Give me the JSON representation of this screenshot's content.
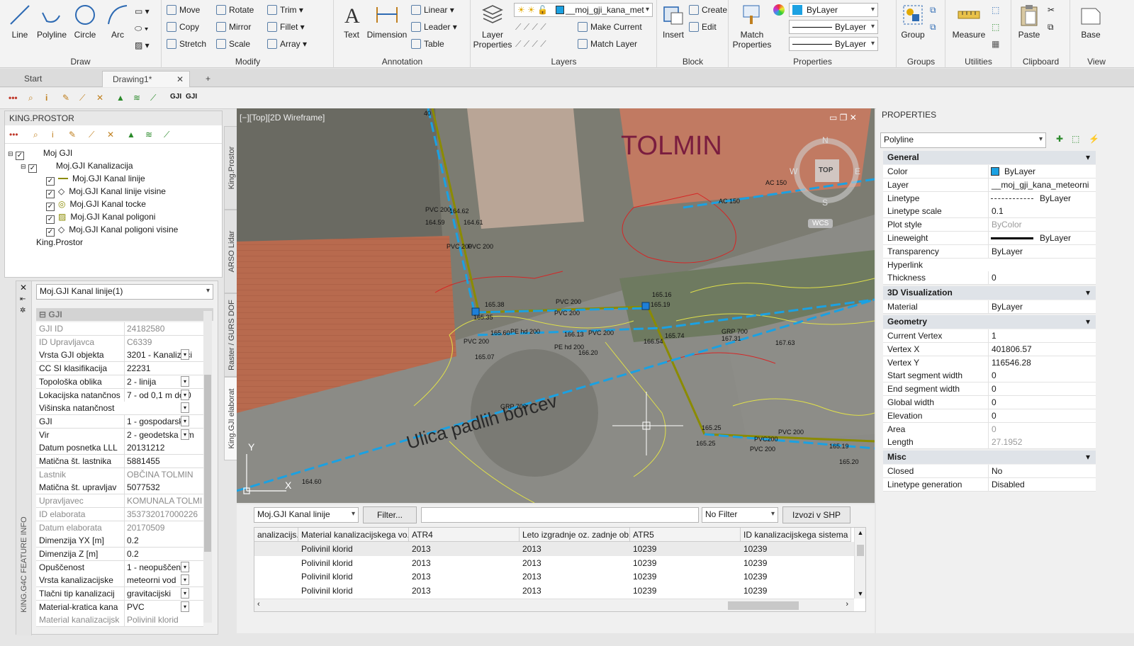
{
  "ribbon": {
    "draw": {
      "label": "Draw",
      "line": "Line",
      "polyline": "Polyline",
      "circle": "Circle",
      "arc": "Arc"
    },
    "modify": {
      "label": "Modify",
      "move": "Move",
      "rotate": "Rotate",
      "trim": "Trim",
      "copy": "Copy",
      "mirror": "Mirror",
      "fillet": "Fillet",
      "stretch": "Stretch",
      "scale": "Scale",
      "array": "Array"
    },
    "annotation": {
      "label": "Annotation",
      "text": "Text",
      "dimension": "Dimension",
      "linear": "Linear",
      "leader": "Leader",
      "table": "Table"
    },
    "layers": {
      "label": "Layers",
      "layer_properties": "Layer Properties",
      "current_layer": "__moj_gji_kana_met",
      "make_current": "Make Current",
      "match_layer": "Match Layer"
    },
    "block": {
      "label": "Block",
      "insert": "Insert",
      "create": "Create",
      "edit": "Edit"
    },
    "properties": {
      "label": "Properties",
      "match_properties": "Match Properties",
      "color": "ByLayer",
      "linetype": "ByLayer",
      "lineweight": "ByLayer"
    },
    "groups": {
      "label": "Groups",
      "group": "Group"
    },
    "utilities": {
      "label": "Utilities",
      "measure": "Measure"
    },
    "clipboard": {
      "label": "Clipboard",
      "paste": "Paste"
    },
    "view": {
      "label": "View",
      "base": "Base"
    }
  },
  "tabs": [
    {
      "label": "Start"
    },
    {
      "label": "Drawing1*"
    }
  ],
  "king_panel": {
    "title": "KING.PROSTOR",
    "tree": [
      "Moj GJI",
      "Moj.GJI Kanalizacija",
      "Moj.GJI Kanal linije",
      "Moj.GJI Kanal linije visine",
      "Moj.GJI Kanal tocke",
      "Moj.GJI Kanal poligoni",
      "Moj.GJI Kanal poligoni visine",
      "King.Prostor"
    ]
  },
  "side_tabs": [
    "King.Prostor",
    "ARSO Lidar",
    "Raster / GURS DOF",
    "King.GJI elaborat"
  ],
  "feature_panel": {
    "vertical_title": "KING.G4C FEATURE INFO",
    "selector": "Moj.GJI Kanal linije(1)",
    "group": "GJI",
    "rows": [
      {
        "k": "GJI ID",
        "v": "24182580",
        "gray": true
      },
      {
        "k": "ID Upravljavca",
        "v": "C6339",
        "gray": true
      },
      {
        "k": "Vrsta GJI objekta",
        "v": "3201 - Kanalizaci",
        "dd": true
      },
      {
        "k": "CC SI klasifikacija",
        "v": "22231"
      },
      {
        "k": "Topološka oblika",
        "v": "2 - linija",
        "dd": true
      },
      {
        "k": "Lokacijska natančnos",
        "v": "7 - od 0,1 m do 0",
        "dd": true
      },
      {
        "k": "Višinska natančnost",
        "v": "",
        "dd": true
      },
      {
        "k": "GJI",
        "v": "1 - gospodarska",
        "dd": true
      },
      {
        "k": "Vir",
        "v": "2 - geodetska izm",
        "dd": true
      },
      {
        "k": "Datum posnetka LLL",
        "v": "20131212"
      },
      {
        "k": "Matična št. lastnika",
        "v": "5881455"
      },
      {
        "k": "Lastnik",
        "v": "OBČINA TOLMIN",
        "gray": true
      },
      {
        "k": "Matična št. upravljav",
        "v": "5077532"
      },
      {
        "k": "Upravljavec",
        "v": "KOMUNALA TOLMII",
        "gray": true
      },
      {
        "k": "ID elaborata",
        "v": "353732017000226",
        "gray": true
      },
      {
        "k": "Datum elaborata",
        "v": "20170509",
        "gray": true
      },
      {
        "k": "Dimenzija YX [m]",
        "v": "0.2"
      },
      {
        "k": "Dimenzija Z [m]",
        "v": "0.2"
      },
      {
        "k": "Opuščenost",
        "v": "1 - neopuščeni o",
        "dd": true
      },
      {
        "k": "Vrsta kanalizacijske",
        "v": "meteorni vod",
        "dd": true
      },
      {
        "k": "Tlačni tip kanalizacij",
        "v": "gravitacijski",
        "dd": true
      },
      {
        "k": "Material-kratica kana",
        "v": "PVC",
        "dd": true
      },
      {
        "k": "Material kanalizacijsk",
        "v": "Polivinil klorid",
        "gray": true
      }
    ]
  },
  "viewport": {
    "label": "[−][Top][2D Wireframe]",
    "town": "TOLMIN",
    "street": "Ulica padlih borcev",
    "compass": {
      "n": "N",
      "s": "S",
      "e": "E",
      "w": "W",
      "top": "TOP",
      "wcs": "WCS"
    },
    "ucs": {
      "x": "X",
      "y": "Y"
    },
    "labels": [
      "PVC 200",
      "164.62",
      "164.59",
      "164.61",
      "PVC 200",
      "PVC 200",
      "165.38",
      "165.35",
      "PVC 200",
      "165.16",
      "165.19",
      "PVC 200",
      "PE hd 200",
      "166.13",
      "PVC 200",
      "165.60",
      "PVC 200",
      "165.07",
      "PE hd 200",
      "166.20",
      "165.74",
      "166.54",
      "GRP 700",
      "167.31",
      "167.63",
      "PVC 200",
      "GRP 700",
      "165.25",
      "165.25",
      "PVC200",
      "PVC 200",
      "165.19",
      "165.20",
      "164.60",
      "AC 150",
      "AC 150",
      "40"
    ]
  },
  "grid": {
    "layer_select": "Moj.GJI Kanal linije",
    "filter_button": "Filter...",
    "filter_text": "",
    "filter_mode": "No Filter",
    "export_button": "Izvozi v SHP",
    "columns": [
      "analizacijs...",
      "Material kanalizacijskega vo...",
      "ATR4",
      "Leto izgradnje oz. zadnje ob...",
      "ATR5",
      "ID kanalizacijskega sistema"
    ],
    "rows": [
      [
        "",
        "Polivinil klorid",
        "2013",
        "2013",
        "10239",
        "10239"
      ],
      [
        "",
        "Polivinil klorid",
        "2013",
        "2013",
        "10239",
        "10239"
      ],
      [
        "",
        "Polivinil klorid",
        "2013",
        "2013",
        "10239",
        "10239"
      ],
      [
        "",
        "Polivinil klorid",
        "2013",
        "2013",
        "10239",
        "10239"
      ]
    ]
  },
  "properties_panel": {
    "title": "PROPERTIES",
    "object": "Polyline",
    "sections": [
      {
        "name": "General",
        "rows": [
          [
            "Color",
            "ByLayer"
          ],
          [
            "Layer",
            "__moj_gji_kana_meteorni"
          ],
          [
            "Linetype",
            "ByLayer"
          ],
          [
            "Linetype scale",
            "0.1"
          ],
          [
            "Plot style",
            "ByColor"
          ],
          [
            "Lineweight",
            "ByLayer"
          ],
          [
            "Transparency",
            "ByLayer"
          ],
          [
            "Hyperlink",
            ""
          ],
          [
            "Thickness",
            "0"
          ]
        ]
      },
      {
        "name": "3D Visualization",
        "rows": [
          [
            "Material",
            "ByLayer"
          ]
        ]
      },
      {
        "name": "Geometry",
        "rows": [
          [
            "Current Vertex",
            "1"
          ],
          [
            "Vertex X",
            "401806.57"
          ],
          [
            "Vertex Y",
            "116546.28"
          ],
          [
            "Start segment width",
            "0"
          ],
          [
            "End segment width",
            "0"
          ],
          [
            "Global width",
            "0"
          ],
          [
            "Elevation",
            "0"
          ],
          [
            "Area",
            "0"
          ],
          [
            "Length",
            "27.1952"
          ]
        ]
      },
      {
        "name": "Misc",
        "rows": [
          [
            "Closed",
            "No"
          ],
          [
            "Linetype generation",
            "Disabled"
          ]
        ]
      }
    ]
  }
}
